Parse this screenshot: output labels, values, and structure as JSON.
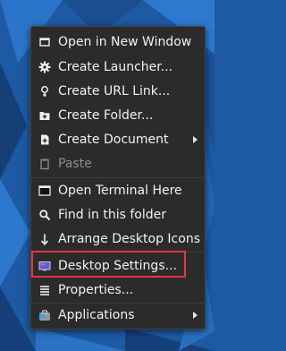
{
  "colors": {
    "menu_bg": "#2b2b2b",
    "menu_text": "#f2f2f2",
    "disabled_text": "#8d8d8d",
    "highlight": "#e0393e",
    "desktop": "#1d5aa3"
  },
  "menu": {
    "items": [
      {
        "label": "Open in New Window",
        "icon": "window-icon"
      },
      {
        "label": "Create Launcher...",
        "icon": "gear-icon"
      },
      {
        "label": "Create URL Link...",
        "icon": "link-icon"
      },
      {
        "label": "Create Folder...",
        "icon": "folder-plus-icon"
      },
      {
        "label": "Create Document",
        "icon": "document-plus-icon",
        "submenu": true
      },
      {
        "label": "Paste",
        "icon": "clipboard-icon",
        "disabled": true
      },
      {
        "label": "Open Terminal Here",
        "icon": "terminal-icon"
      },
      {
        "label": "Find in this folder",
        "icon": "search-icon"
      },
      {
        "label": "Arrange Desktop Icons",
        "icon": "arrange-icon"
      },
      {
        "label": "Desktop Settings...",
        "icon": "desktop-settings-icon",
        "highlighted": true
      },
      {
        "label": "Properties...",
        "icon": "properties-icon"
      },
      {
        "label": "Applications",
        "icon": "applications-icon",
        "submenu": true
      }
    ]
  }
}
